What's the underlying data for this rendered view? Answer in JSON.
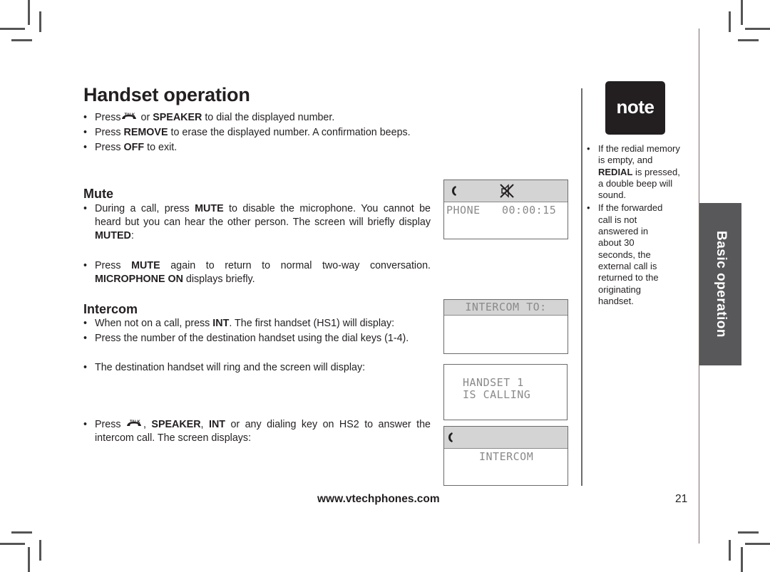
{
  "page": {
    "title": "Handset operation",
    "intro_bullets": [
      {
        "pre": "Press",
        "icon": "talk-key-icon",
        "mid": " or ",
        "bold": "SPEAKER",
        "post": " to dial the displayed number."
      },
      {
        "pre": "Press ",
        "bold": "REMOVE",
        "post": " to erase the displayed number. A confirmation beeps."
      },
      {
        "pre": "Press ",
        "bold": "OFF",
        "post": " to exit."
      }
    ],
    "talk_icon_label": "TALK",
    "mute": {
      "heading": "Mute",
      "bullet1": {
        "pre": "During a call, press ",
        "bold": "MUTE",
        "mid": " to disable the microphone. You cannot be heard but you can hear the other person. The screen will briefly display ",
        "bold2": "MUTED",
        "post": ":"
      },
      "bullet2": {
        "pre": "Press ",
        "bold": "MUTE",
        "mid": " again to return to normal two-way conversation. ",
        "bold2": "MICROPHONE ON",
        "post": " displays briefly."
      }
    },
    "intercom": {
      "heading": "Intercom",
      "bullet1": {
        "pre": "When not on a call, press ",
        "bold": "INT",
        "post": ". The first handset (HS1) will display:"
      },
      "bullet2": {
        "text": "Press the number of the destination handset using the dial keys (1-4)."
      },
      "bullet3": {
        "text": "The destination handset will ring and the screen will display:"
      },
      "bullet4": {
        "pre": "Press ",
        "icon": "talk-key-icon",
        "mid": ", ",
        "bold": "SPEAKER",
        "mid2": ", ",
        "bold2": "INT",
        "post": " or any dialing key on HS2 to answer the intercom call. The screen displays:"
      }
    },
    "screens": {
      "muted": {
        "line1": "PHONE",
        "timer": "00:00:15",
        "icons": [
          "handset-icon",
          "speaker-muted-icon"
        ]
      },
      "intercom_to": {
        "header": "INTERCOM TO:"
      },
      "calling": {
        "line1": "HANDSET 1",
        "line2": "IS CALLING"
      },
      "intercom": {
        "line1": "INTERCOM",
        "icons": [
          "handset-icon"
        ]
      }
    },
    "note": {
      "badge": "note",
      "items": [
        {
          "pre": "If the redial memory is empty, and ",
          "bold": "REDIAL",
          "post": " is pressed, a double beep will sound."
        },
        {
          "text": "If the forwarded call is not answered in about 30 seconds, the external call is returned to the originating handset."
        }
      ]
    },
    "side_tab": "Basic operation",
    "footer": {
      "url": "www.vtechphones.com",
      "page_number": "21"
    }
  }
}
